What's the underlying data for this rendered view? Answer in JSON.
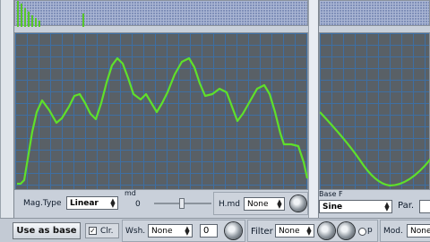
{
  "left_panel": {
    "mag_type_label": "Mag.Type",
    "mag_type_value": "Linear",
    "mod_label": "md",
    "mod_value": "0",
    "h_mod_label": "H.md",
    "h_mod_value": "None"
  },
  "right_panel": {
    "base_f_label": "Base F",
    "base_f_value": "Sine",
    "par_label": "Par."
  },
  "bottom_bar": {
    "use_as_base_label": "Use as base",
    "clr_label": "Clr.",
    "wsh_label": "Wsh.",
    "wsh_value": "None",
    "wsh_amount": "0",
    "filter_label": "Filter",
    "filter_value": "None",
    "p_label": "p",
    "mod_label": "Mod.",
    "mod_value": "None"
  },
  "colors": {
    "waveform": "#5fe02a",
    "graph_bg": "#596066",
    "grid_line": "#3e6fa3",
    "spectrum_bg": "#7f8fb8"
  },
  "icons": [
    "dropdown-arrow-icon",
    "knob-icon",
    "checkbox-icon",
    "radio-icon"
  ]
}
